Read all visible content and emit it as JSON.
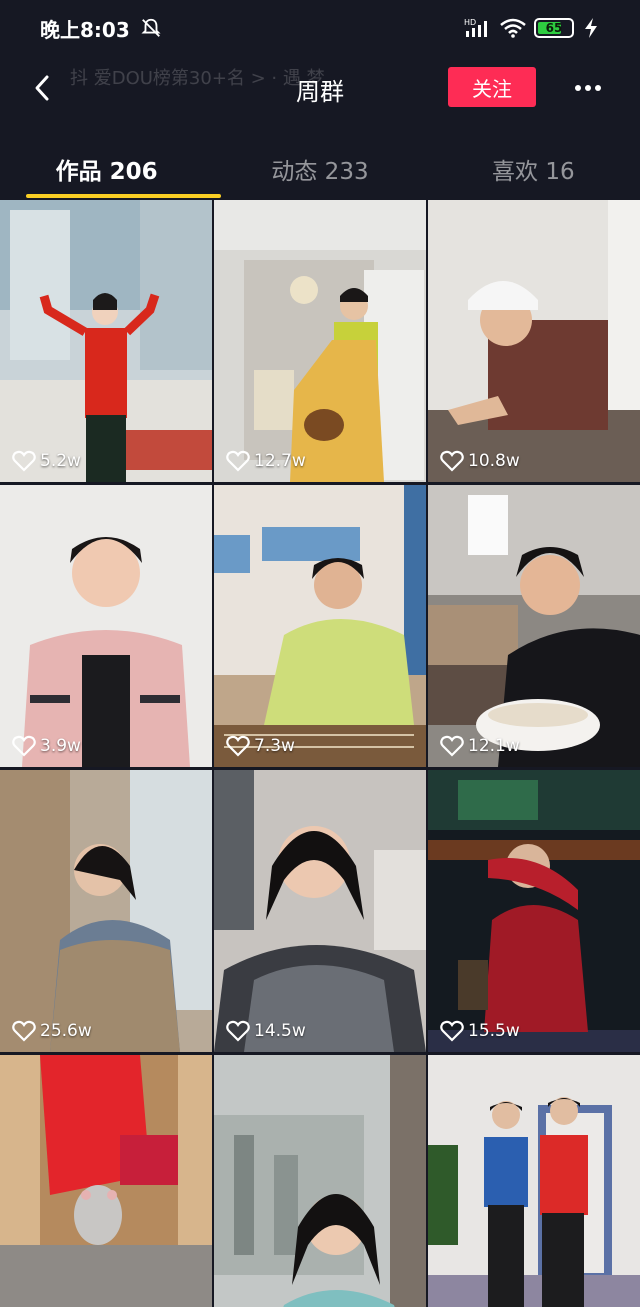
{
  "status_bar": {
    "time": "晚上8:03",
    "network": "HD",
    "battery": "65"
  },
  "header": {
    "ghost_text": "抖 爱DOU榜第30+名 >   ·  遇 梦",
    "title": "周群",
    "follow_label": "关注"
  },
  "tabs": [
    {
      "label": "作品 206",
      "active": true
    },
    {
      "label": "动态 233",
      "active": false
    },
    {
      "label": "喜欢 16",
      "active": false
    }
  ],
  "videos": [
    {
      "likes": "5.2w"
    },
    {
      "likes": "12.7w"
    },
    {
      "likes": "10.8w"
    },
    {
      "likes": "3.9w"
    },
    {
      "likes": "7.3w"
    },
    {
      "likes": "12.1w"
    },
    {
      "likes": "25.6w"
    },
    {
      "likes": "14.5w"
    },
    {
      "likes": "15.5w"
    },
    {
      "likes": ""
    },
    {
      "likes": ""
    },
    {
      "likes": ""
    }
  ]
}
